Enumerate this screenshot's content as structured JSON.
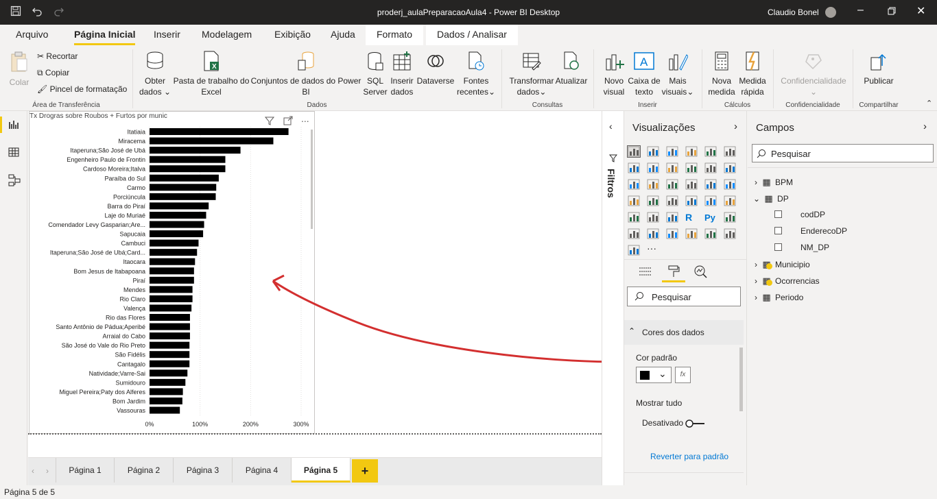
{
  "window": {
    "title": "proderj_aulaPreparacaoAula4 - Power BI Desktop",
    "user": "Claudio Bonel"
  },
  "tabs": [
    "Arquivo",
    "Página Inicial",
    "Inserir",
    "Modelagem",
    "Exibição",
    "Ajuda"
  ],
  "context_tabs": [
    "Formato",
    "Dados / Analisar"
  ],
  "ribbon": {
    "paste": "Colar",
    "cut": "Recortar",
    "copy": "Copiar",
    "format_painter": "Pincel de formatação",
    "clipboard_group": "Área de Transferência",
    "get_data": [
      "Obter",
      "dados"
    ],
    "excel": [
      "Pasta de trabalho do",
      "Excel"
    ],
    "datasets": [
      "Conjuntos de dados do Power",
      "BI"
    ],
    "sql": [
      "SQL",
      "Server"
    ],
    "enter_data": [
      "Inserir",
      "dados"
    ],
    "dataverse": "Dataverse",
    "recent": [
      "Fontes",
      "recentes"
    ],
    "data_group": "Dados",
    "transform": [
      "Transformar",
      "dados"
    ],
    "refresh": "Atualizar",
    "queries_group": "Consultas",
    "new_visual": [
      "Novo",
      "visual"
    ],
    "textbox": [
      "Caixa de",
      "texto"
    ],
    "more_visuals": [
      "Mais",
      "visuais"
    ],
    "insert_group": "Inserir",
    "new_measure": [
      "Nova",
      "medida"
    ],
    "quick_measure": [
      "Medida",
      "rápida"
    ],
    "calc_group": "Cálculos",
    "sensitivity": "Confidencialidade",
    "sensitivity_group": "Confidencialidade",
    "publish": "Publicar",
    "share_group": "Compartilhar"
  },
  "chart_data": {
    "type": "bar",
    "title": "Tx Drogras sobre Roubos + Furtos por munic",
    "categories": [
      "Itatiaia",
      "Miracema",
      "Itaperuna;São José de Ubá",
      "Engenheiro Paulo de Frontin",
      "Cardoso Moreira;Italva",
      "Paraíba do Sul",
      "Carmo",
      "Porciúncula",
      "Barra do Piraí",
      "Laje do Muriaé",
      "Comendador Levy Gasparian;Are...",
      "Sapucaia",
      "Cambuci",
      "Itaperuna;São José de Ubá;Card...",
      "Itaocara",
      "Bom Jesus de Itabapoana",
      "Piraí",
      "Mendes",
      "Rio Claro",
      "Valença",
      "Rio das Flores",
      "Santo Antônio de Pádua;Aperibé",
      "Arraial do Cabo",
      "São José do Vale do Rio Preto",
      "São Fidélis",
      "Cantagalo",
      "Natividade;Varre-Sai",
      "Sumidouro",
      "Miguel Pereira;Paty dos Alferes",
      "Bom Jardim",
      "Vassouras"
    ],
    "values": [
      275,
      245,
      180,
      150,
      150,
      137,
      132,
      131,
      117,
      112,
      108,
      106,
      97,
      94,
      90,
      88,
      88,
      85,
      85,
      83,
      80,
      80,
      80,
      79,
      79,
      79,
      75,
      71,
      66,
      65,
      60
    ],
    "xticks": [
      "0%",
      "100%",
      "200%",
      "300%"
    ],
    "xlim": [
      0,
      300
    ],
    "unit": "%",
    "bar_color": "#000000",
    "grid": true,
    "xlabel": "",
    "ylabel": ""
  },
  "filters_label": "Filtros",
  "viz": {
    "title": "Visualizações",
    "search_placeholder": "Pesquisar",
    "section": "Cores dos dados",
    "default_color_label": "Cor padrão",
    "fx": "fx",
    "show_all": "Mostrar tudo",
    "toggle_state": "Desativado",
    "reset": "Reverter para padrão",
    "dots": "..."
  },
  "fields": {
    "title": "Campos",
    "search_placeholder": "Pesquisar",
    "tables": [
      "BPM",
      "DP",
      "Municipio",
      "Ocorrencias",
      "Periodo"
    ],
    "dp_columns": [
      "codDP",
      "EnderecoDP",
      "NM_DP"
    ]
  },
  "pages": [
    "Página 1",
    "Página 2",
    "Página 3",
    "Página 4",
    "Página 5"
  ],
  "add_page": "+",
  "status": "Página 5 de 5",
  "annotation_color": "#d32f2f",
  "accent": "#f2c811"
}
